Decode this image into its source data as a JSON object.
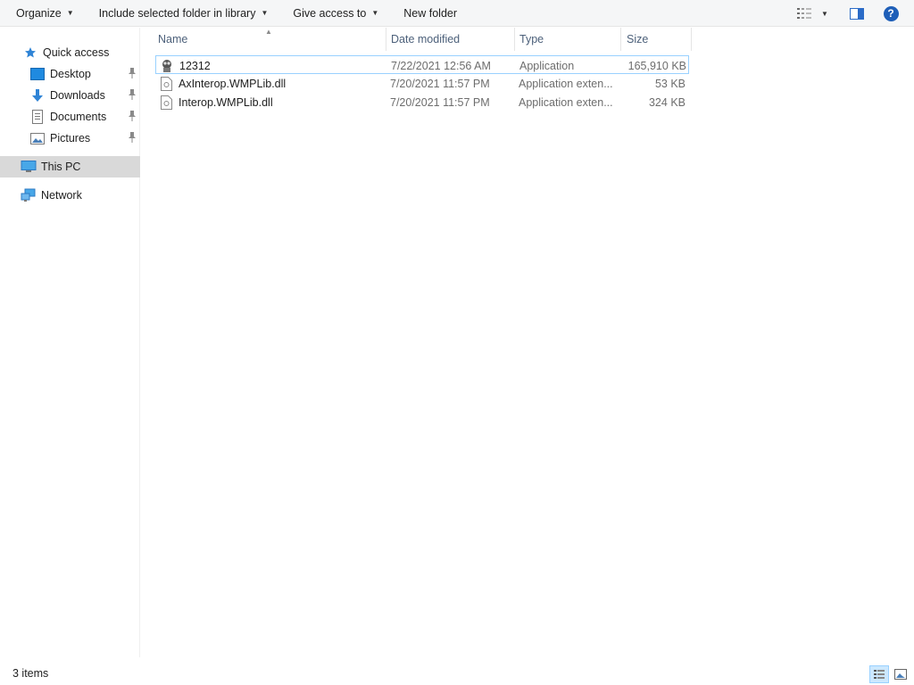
{
  "toolbar": {
    "organize": "Organize",
    "include_in_library": "Include selected folder in library",
    "give_access": "Give access to",
    "new_folder": "New folder",
    "help_glyph": "?"
  },
  "nav": {
    "quick_access": "Quick access",
    "items": [
      {
        "label": "Desktop",
        "icon": "desktop-icon",
        "pinned": true
      },
      {
        "label": "Downloads",
        "icon": "downloads-icon",
        "pinned": true
      },
      {
        "label": "Documents",
        "icon": "documents-icon",
        "pinned": true
      },
      {
        "label": "Pictures",
        "icon": "pictures-icon",
        "pinned": true
      }
    ],
    "this_pc": "This PC",
    "network": "Network"
  },
  "columns": {
    "name": "Name",
    "date_modified": "Date modified",
    "type": "Type",
    "size": "Size"
  },
  "files": [
    {
      "name": "12312",
      "date": "7/22/2021 12:56 AM",
      "type": "Application",
      "size": "165,910 KB",
      "icon": "application-icon",
      "selected": true
    },
    {
      "name": "AxInterop.WMPLib.dll",
      "date": "7/20/2021 11:57 PM",
      "type": "Application exten...",
      "size": "53 KB",
      "icon": "dll-file-icon",
      "selected": false
    },
    {
      "name": "Interop.WMPLib.dll",
      "date": "7/20/2021 11:57 PM",
      "type": "Application exten...",
      "size": "324 KB",
      "icon": "dll-file-icon",
      "selected": false
    }
  ],
  "status": {
    "item_count": "3 items"
  },
  "colors": {
    "accent": "#1f5fb8",
    "selection_border": "#99d1ff",
    "selected_nav_bg": "#d9d9d9"
  }
}
